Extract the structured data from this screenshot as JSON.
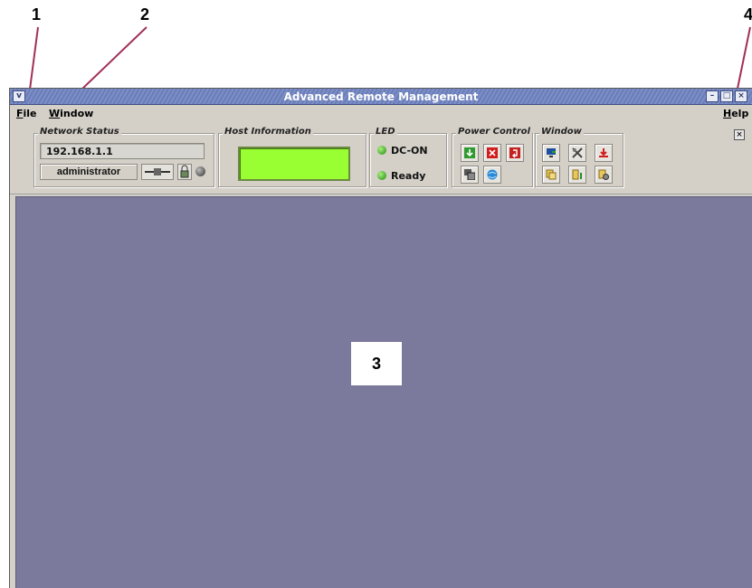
{
  "callouts": {
    "c1": "1",
    "c2": "2",
    "c3": "3",
    "c4": "4"
  },
  "window": {
    "title": "Advanced Remote Management",
    "controls": {
      "minimize": "–",
      "maximize": "□",
      "close": "×",
      "menu": "v"
    }
  },
  "menu": {
    "file": "File",
    "window": "Window",
    "help": "Help"
  },
  "network_status": {
    "label": "Network Status",
    "ip": "192.168.1.1",
    "user": "administrator"
  },
  "host_information": {
    "label": "Host Information"
  },
  "led": {
    "label": "LED",
    "items": [
      {
        "label": "DC-ON",
        "color": "#3cc11e"
      },
      {
        "label": "Ready",
        "color": "#3cc11e"
      }
    ]
  },
  "power_control": {
    "label": "Power Control",
    "buttons": [
      "power-on-icon",
      "power-off-icon",
      "reset-icon",
      "remote-console-icon",
      "globe-icon"
    ]
  },
  "window_group": {
    "label": "Window",
    "buttons": [
      "monitor-icon",
      "tools-icon",
      "alert-icon",
      "copy-icon",
      "status-icon",
      "settings-icon"
    ]
  },
  "toolbar": {
    "close": "×"
  },
  "colors": {
    "desktop": "#7b7a9c",
    "lcd": "#99ff33",
    "titlebar": "#7d8fc7"
  }
}
